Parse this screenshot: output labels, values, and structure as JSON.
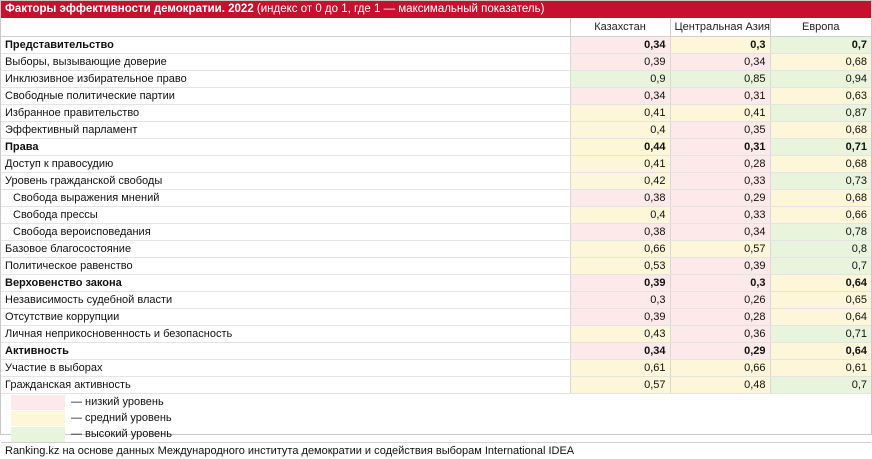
{
  "title": {
    "bold": "Факторы эффективности демократии. 2022",
    "rest": " (индекс от 0 до 1, где 1 — максимальный показатель)"
  },
  "columns": [
    "Казахстан",
    "Центральная Азия",
    "Европа"
  ],
  "rows": [
    {
      "label": "Представительство",
      "bold": true,
      "indent": false,
      "values": [
        "0,34",
        "0,3",
        "0,7"
      ],
      "levels": [
        "low",
        "mid",
        "high"
      ]
    },
    {
      "label": "Выборы, вызывающие доверие",
      "bold": false,
      "indent": false,
      "values": [
        "0,39",
        "0,34",
        "0,68"
      ],
      "levels": [
        "low",
        "low",
        "mid"
      ]
    },
    {
      "label": "Инклюзивное избирательное право",
      "bold": false,
      "indent": false,
      "values": [
        "0,9",
        "0,85",
        "0,94"
      ],
      "levels": [
        "high",
        "high",
        "high"
      ]
    },
    {
      "label": "Свободные политические партии",
      "bold": false,
      "indent": false,
      "values": [
        "0,34",
        "0,31",
        "0,63"
      ],
      "levels": [
        "low",
        "low",
        "mid"
      ]
    },
    {
      "label": "Избранное правительство",
      "bold": false,
      "indent": false,
      "values": [
        "0,41",
        "0,41",
        "0,87"
      ],
      "levels": [
        "mid",
        "mid",
        "high"
      ]
    },
    {
      "label": "Эффективный парламент",
      "bold": false,
      "indent": false,
      "values": [
        "0,4",
        "0,35",
        "0,68"
      ],
      "levels": [
        "mid",
        "low",
        "mid"
      ]
    },
    {
      "label": "Права",
      "bold": true,
      "indent": false,
      "values": [
        "0,44",
        "0,31",
        "0,71"
      ],
      "levels": [
        "mid",
        "low",
        "high"
      ]
    },
    {
      "label": "Доступ к правосудию",
      "bold": false,
      "indent": false,
      "values": [
        "0,41",
        "0,28",
        "0,68"
      ],
      "levels": [
        "mid",
        "low",
        "mid"
      ]
    },
    {
      "label": "Уровень гражданской свободы",
      "bold": false,
      "indent": false,
      "values": [
        "0,42",
        "0,33",
        "0,73"
      ],
      "levels": [
        "mid",
        "low",
        "high"
      ]
    },
    {
      "label": "Свобода выражения мнений",
      "bold": false,
      "indent": true,
      "values": [
        "0,38",
        "0,29",
        "0,68"
      ],
      "levels": [
        "low",
        "low",
        "mid"
      ]
    },
    {
      "label": "Свобода прессы",
      "bold": false,
      "indent": true,
      "values": [
        "0,4",
        "0,33",
        "0,66"
      ],
      "levels": [
        "mid",
        "low",
        "mid"
      ]
    },
    {
      "label": "Свобода вероисповедания",
      "bold": false,
      "indent": true,
      "values": [
        "0,38",
        "0,34",
        "0,78"
      ],
      "levels": [
        "low",
        "low",
        "high"
      ]
    },
    {
      "label": "Базовое благосостояние",
      "bold": false,
      "indent": false,
      "values": [
        "0,66",
        "0,57",
        "0,8"
      ],
      "levels": [
        "mid",
        "mid",
        "high"
      ]
    },
    {
      "label": "Политическое равенство",
      "bold": false,
      "indent": false,
      "values": [
        "0,53",
        "0,39",
        "0,7"
      ],
      "levels": [
        "mid",
        "low",
        "high"
      ]
    },
    {
      "label": "Верховенство закона",
      "bold": true,
      "indent": false,
      "values": [
        "0,39",
        "0,3",
        "0,64"
      ],
      "levels": [
        "low",
        "low",
        "mid"
      ]
    },
    {
      "label": "Независимость судебной власти",
      "bold": false,
      "indent": false,
      "values": [
        "0,3",
        "0,26",
        "0,65"
      ],
      "levels": [
        "low",
        "low",
        "mid"
      ]
    },
    {
      "label": "Отсутствие коррупции",
      "bold": false,
      "indent": false,
      "values": [
        "0,39",
        "0,28",
        "0,64"
      ],
      "levels": [
        "low",
        "low",
        "mid"
      ]
    },
    {
      "label": "Личная неприкосновенность и безопасность",
      "bold": false,
      "indent": false,
      "values": [
        "0,43",
        "0,36",
        "0,71"
      ],
      "levels": [
        "mid",
        "low",
        "high"
      ]
    },
    {
      "label": "Активность",
      "bold": true,
      "indent": false,
      "values": [
        "0,34",
        "0,29",
        "0,64"
      ],
      "levels": [
        "low",
        "low",
        "mid"
      ]
    },
    {
      "label": "Участие в выборах",
      "bold": false,
      "indent": false,
      "values": [
        "0,61",
        "0,66",
        "0,61"
      ],
      "levels": [
        "mid",
        "mid",
        "mid"
      ]
    },
    {
      "label": "Гражданская активность",
      "bold": false,
      "indent": false,
      "values": [
        "0,57",
        "0,48",
        "0,7"
      ],
      "levels": [
        "mid",
        "mid",
        "high"
      ]
    }
  ],
  "legend": [
    {
      "level": "low",
      "text": "— низкий уровень"
    },
    {
      "level": "mid",
      "text": "— средний уровень"
    },
    {
      "level": "high",
      "text": "— высокий уровень"
    }
  ],
  "colors": {
    "header": "#c8102e",
    "low": "#fde9ea",
    "mid": "#fdf6d9",
    "high": "#e9f4dc"
  },
  "source": "Ranking.kz на основе данных Международного института демократии и содействия выборам International IDEA"
}
